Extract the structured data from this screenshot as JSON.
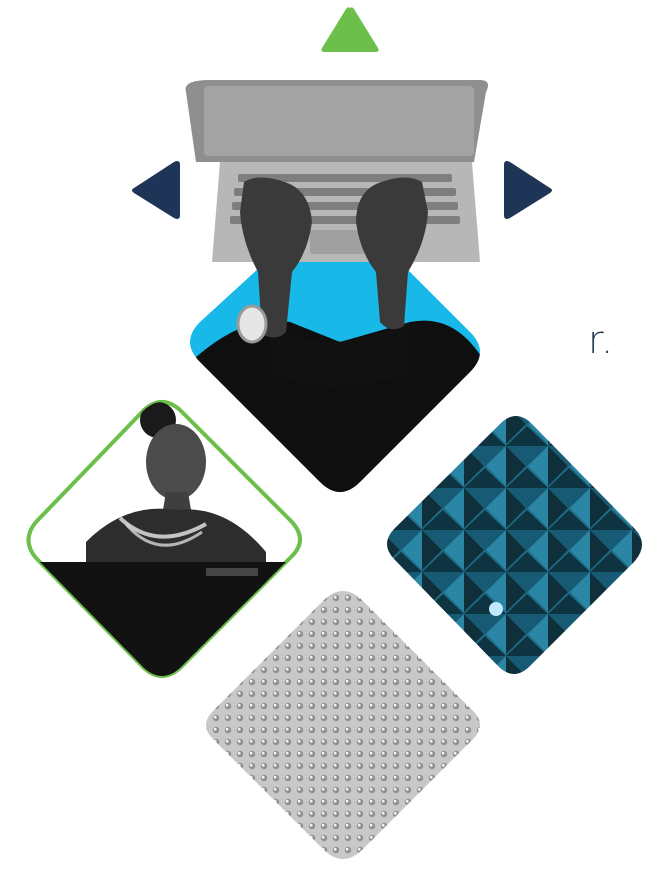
{
  "page": {
    "text_fragment": "r.",
    "accent_colors": {
      "green": "#6dbf4b",
      "navy": "#1f3557",
      "cyan": "#18b8e8",
      "teal": "#1e6b86",
      "black": "#0f0f10",
      "gray": "#c8c8c8"
    }
  },
  "arrows": {
    "up": {
      "icon": "triangle-up-icon",
      "color": "#6dbf4b"
    },
    "left": {
      "icon": "triangle-left-icon",
      "color": "#1f3557"
    },
    "right": {
      "icon": "triangle-right-icon",
      "color": "#1f3557"
    }
  },
  "tiles": [
    {
      "name": "laptop-typing-tile",
      "icon": "laptop-photo-icon"
    },
    {
      "name": "woman-laptop-tile",
      "icon": "person-photo-icon"
    },
    {
      "name": "architecture-tile",
      "icon": "building-pattern-icon"
    },
    {
      "name": "dotted-texture-tile",
      "icon": "texture-pattern-icon"
    }
  ]
}
